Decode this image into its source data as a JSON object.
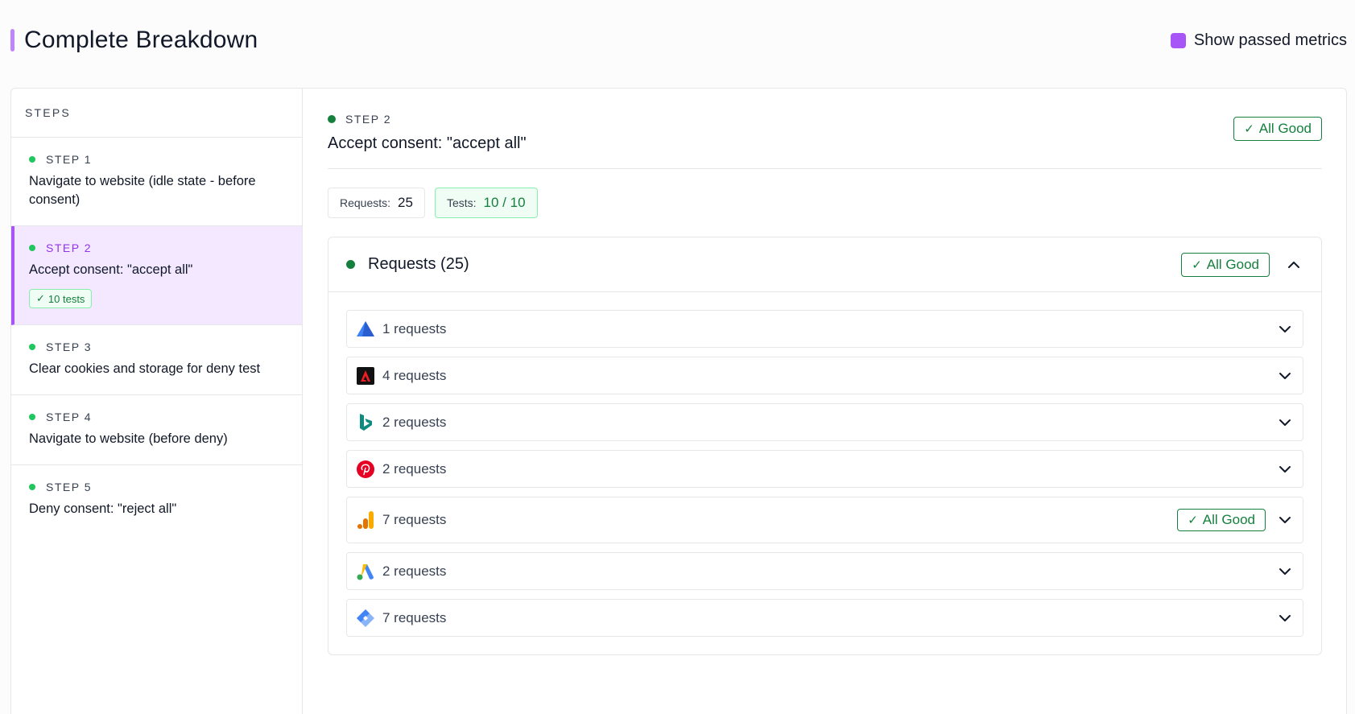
{
  "header": {
    "title": "Complete Breakdown",
    "toggle_label": "Show passed metrics",
    "accent_color": "#a855f7"
  },
  "sidebar": {
    "heading": "STEPS",
    "steps": [
      {
        "label": "STEP 1",
        "title": "Navigate to website (idle state - before consent)"
      },
      {
        "label": "STEP 2",
        "title": "Accept consent: \"accept all\"",
        "badge": "10 tests",
        "active": true
      },
      {
        "label": "STEP 3",
        "title": "Clear cookies and storage for deny test"
      },
      {
        "label": "STEP 4",
        "title": "Navigate to website (before deny)"
      },
      {
        "label": "STEP 5",
        "title": "Deny consent: \"reject all\""
      }
    ]
  },
  "main": {
    "step_label": "STEP 2",
    "step_title": "Accept consent: \"accept all\"",
    "status_badge": "All Good",
    "stats": {
      "requests_label": "Requests:",
      "requests_value": "25",
      "tests_label": "Tests:",
      "tests_value": "10 / 10"
    },
    "requests_panel": {
      "title": "Requests (25)",
      "status_badge": "All Good",
      "rows": [
        {
          "icon": "triangle-vendor-icon",
          "count": "1 requests"
        },
        {
          "icon": "adobe-icon",
          "count": "4 requests"
        },
        {
          "icon": "bing-icon",
          "count": "2 requests"
        },
        {
          "icon": "pinterest-icon",
          "count": "2 requests"
        },
        {
          "icon": "google-analytics-icon",
          "count": "7 requests",
          "badge": "All Good"
        },
        {
          "icon": "google-ads-icon",
          "count": "2 requests"
        },
        {
          "icon": "google-tag-manager-icon",
          "count": "7 requests"
        }
      ]
    }
  },
  "colors": {
    "success": "#15803d",
    "step_dot": "#22c55e",
    "active_bg": "#f3e8ff"
  }
}
